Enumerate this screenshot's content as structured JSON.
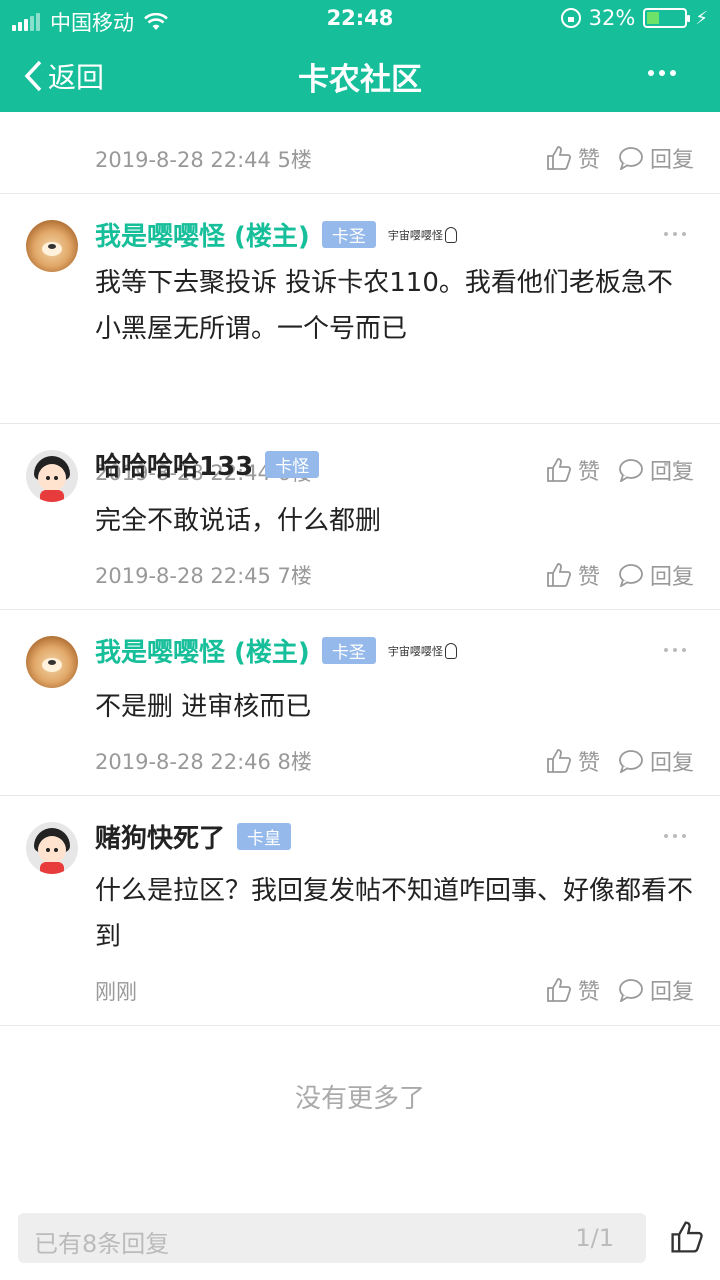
{
  "status_bar": {
    "carrier": "中国移动",
    "time": "22:48",
    "battery": "32%",
    "battery_level": 0.32
  },
  "nav": {
    "back_label": "返回",
    "title": "卡农社区"
  },
  "partial_post": {
    "meta": "2019-8-28 22:44  5楼"
  },
  "actions": {
    "like_label": "赞",
    "reply_label": "回复"
  },
  "posts": [
    {
      "name": "我是嘤嘤怪 (楼主)",
      "badge": "卡圣",
      "signature": "宇宙嘤嘤怪",
      "content": "我等下去聚投诉 投诉卡农110。我看他们老板急不    小黑屋无所谓。一个号而已",
      "meta": "2019-8-28 22:44  6楼"
    },
    {
      "name": "哈哈哈哈133",
      "badge": "卡怪",
      "content": "完全不敢说话，什么都删",
      "meta": "2019-8-28 22:45  7楼"
    },
    {
      "name": "我是嘤嘤怪 (楼主)",
      "badge": "卡圣",
      "signature": "宇宙嘤嘤怪",
      "content": "不是删 进审核而已",
      "meta": "2019-8-28 22:46  8楼"
    },
    {
      "name": "赌狗快死了",
      "badge": "卡皇",
      "content": "什么是拉区？我回复发帖不知道咋回事、好像都看不到",
      "meta": "刚刚"
    }
  ],
  "no_more": "没有更多了",
  "bottom": {
    "placeholder": "已有8条回复",
    "page": "1/1"
  },
  "colors": {
    "brand": "#16bf9a",
    "badge": "#94b9ea",
    "op_name": "#16bf9a"
  }
}
